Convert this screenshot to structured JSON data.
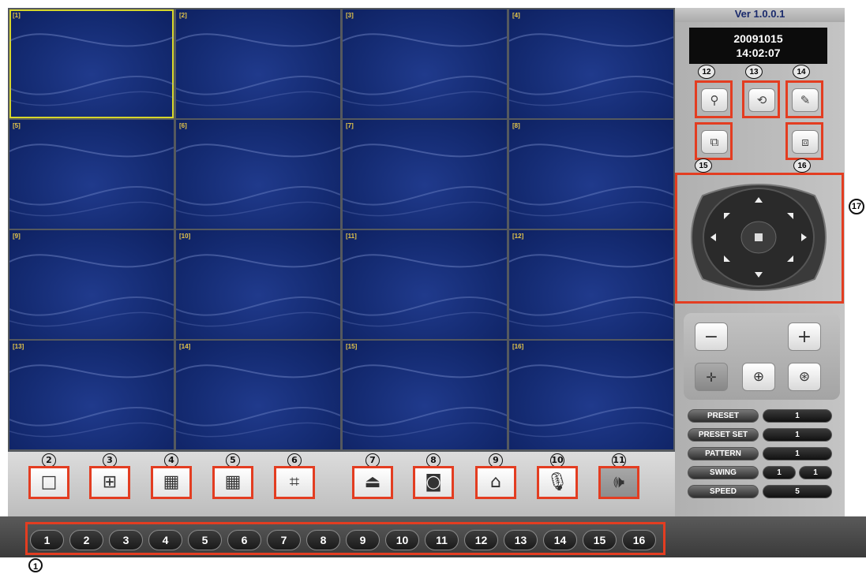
{
  "version": "Ver 1.0.0.1",
  "clock": {
    "date": "20091015",
    "time": "14:02:07"
  },
  "cameras": [
    "[1]",
    "[2]",
    "[3]",
    "[4]",
    "[5]",
    "[6]",
    "[7]",
    "[8]",
    "[9]",
    "[10]",
    "[11]",
    "[12]",
    "[13]",
    "[14]",
    "[15]",
    "[16]"
  ],
  "selected_camera": "[1]",
  "toolbar": [
    {
      "num": "2",
      "icon": "single-layout-icon"
    },
    {
      "num": "3",
      "icon": "quad-layout-icon"
    },
    {
      "num": "4",
      "icon": "nine-layout-icon"
    },
    {
      "num": "5",
      "icon": "sixteen-layout-icon"
    },
    {
      "num": "6",
      "icon": "fullscreen-icon"
    },
    {
      "num": "7",
      "icon": "record-icon"
    },
    {
      "num": "8",
      "icon": "camera-icon"
    },
    {
      "num": "9",
      "icon": "alarm-icon"
    },
    {
      "num": "10",
      "icon": "microphone-icon"
    },
    {
      "num": "11",
      "icon": "speaker-icon"
    }
  ],
  "channels": [
    "1",
    "2",
    "3",
    "4",
    "5",
    "6",
    "7",
    "8",
    "9",
    "10",
    "11",
    "12",
    "13",
    "14",
    "15",
    "16"
  ],
  "channel_bar_marker": "1",
  "right_buttons": [
    {
      "num": "12",
      "icon": "search-icon"
    },
    {
      "num": "13",
      "icon": "network-icon"
    },
    {
      "num": "14",
      "icon": "wrench-icon"
    },
    {
      "num": "15",
      "icon": "connect-icon"
    },
    {
      "num": "16",
      "icon": "disconnect-icon"
    }
  ],
  "ptz_marker": "17",
  "zoom": {
    "minus": "−",
    "plus": "+"
  },
  "settings": [
    {
      "label": "PRESET",
      "values": [
        "1"
      ]
    },
    {
      "label": "PRESET SET",
      "values": [
        "1"
      ]
    },
    {
      "label": "PATTERN",
      "values": [
        "1"
      ]
    },
    {
      "label": "SWING",
      "values": [
        "1",
        "1"
      ]
    },
    {
      "label": "SPEED",
      "values": [
        "5"
      ]
    }
  ]
}
